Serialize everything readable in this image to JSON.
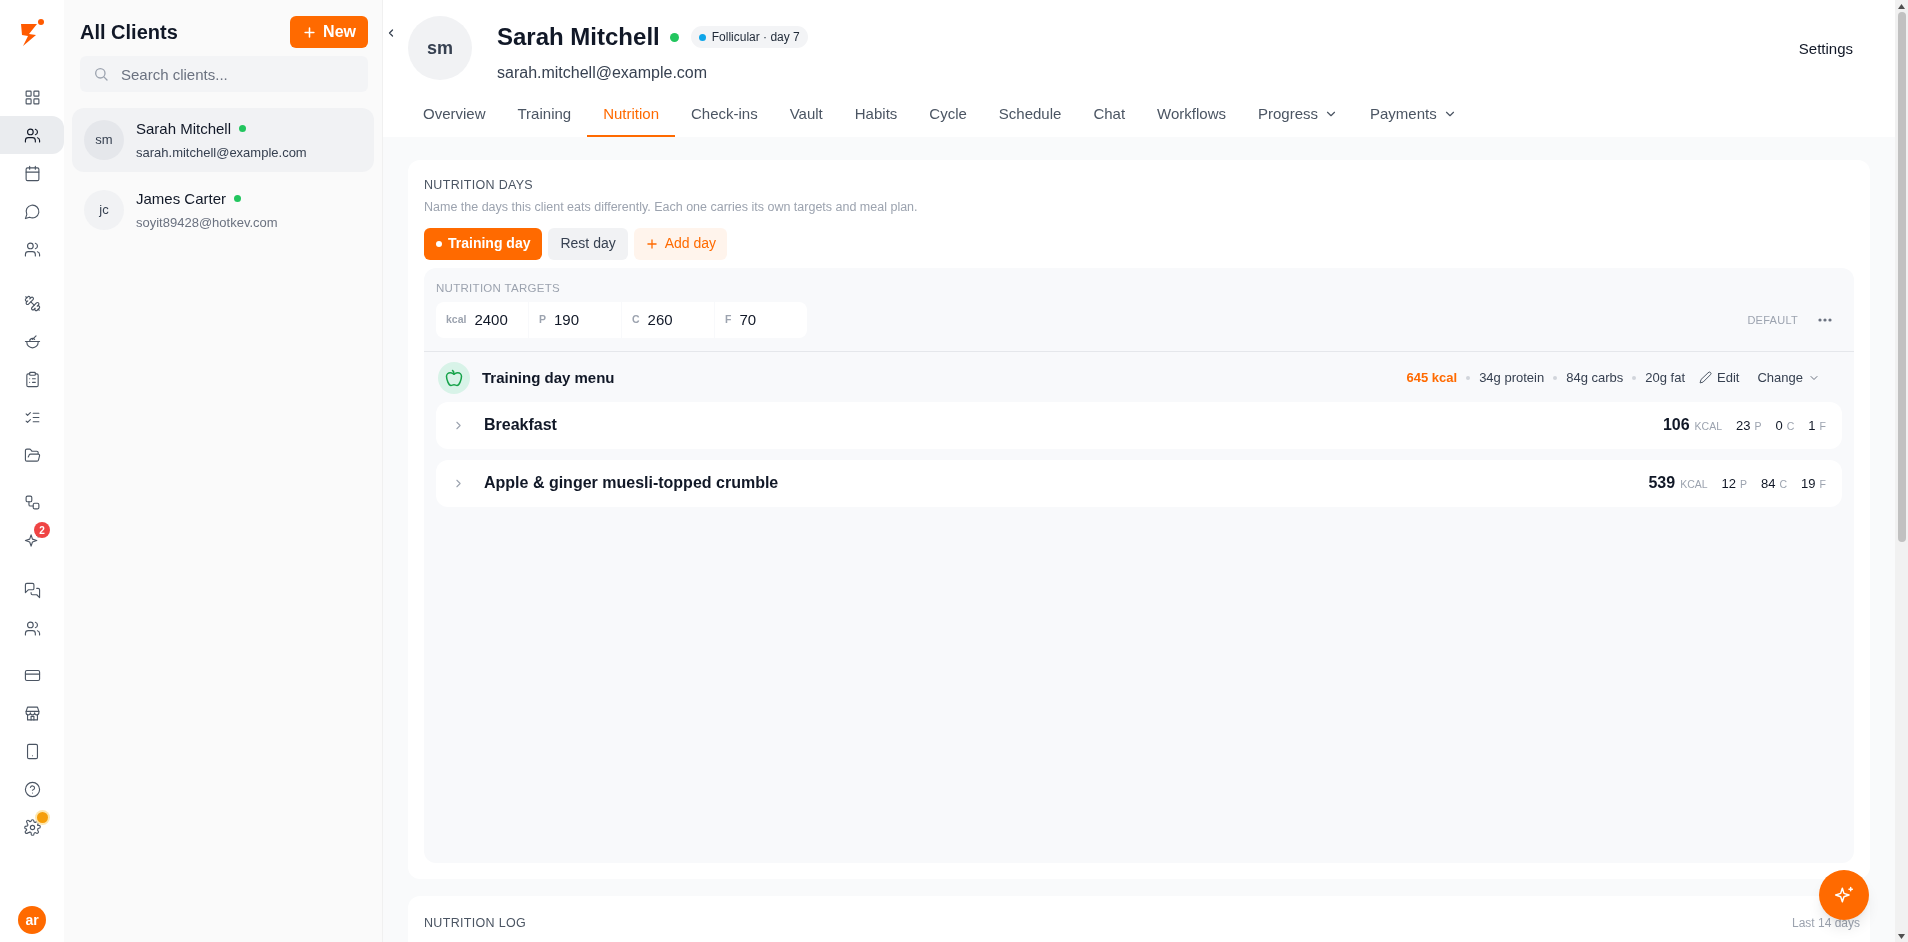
{
  "rail": {
    "items": [
      {
        "selected": false
      },
      {
        "selected": true
      },
      {
        "selected": false
      },
      {
        "selected": false
      },
      {
        "selected": false
      },
      {
        "selected": false
      },
      {
        "selected": false
      },
      {
        "selected": false
      },
      {
        "selected": false
      },
      {
        "selected": false
      },
      {
        "selected": false
      },
      {
        "selected": false,
        "badge": "2"
      },
      {
        "selected": false
      },
      {
        "selected": false
      },
      {
        "selected": false
      },
      {
        "selected": false
      },
      {
        "selected": false
      },
      {
        "selected": false
      },
      {
        "selected": false,
        "alert": true
      }
    ],
    "user_initials": "ar"
  },
  "client_list": {
    "title": "All Clients",
    "new_button": "New",
    "search": {
      "placeholder": "Search clients..."
    },
    "clients": [
      {
        "initials": "sm",
        "name": "Sarah Mitchell",
        "email": "sarah.mitchell@example.com",
        "online": true,
        "selected": true
      },
      {
        "initials": "jc",
        "name": "James Carter",
        "email": "soyit89428@hotkev.com",
        "online": true,
        "selected": false
      }
    ]
  },
  "client_header": {
    "initials": "sm",
    "name": "Sarah Mitchell",
    "online": true,
    "email": "sarah.mitchell@example.com",
    "phase_badge": "Follicular · day 7",
    "settings": "Settings"
  },
  "tabs": [
    {
      "label": "Overview",
      "selected": false,
      "dropdown": false
    },
    {
      "label": "Training",
      "selected": false,
      "dropdown": false
    },
    {
      "label": "Nutrition",
      "selected": true,
      "dropdown": false
    },
    {
      "label": "Check-ins",
      "selected": false,
      "dropdown": false
    },
    {
      "label": "Vault",
      "selected": false,
      "dropdown": false
    },
    {
      "label": "Habits",
      "selected": false,
      "dropdown": false
    },
    {
      "label": "Cycle",
      "selected": false,
      "dropdown": false
    },
    {
      "label": "Schedule",
      "selected": false,
      "dropdown": false
    },
    {
      "label": "Chat",
      "selected": false,
      "dropdown": false
    },
    {
      "label": "Workflows",
      "selected": false,
      "dropdown": false
    },
    {
      "label": "Progress",
      "selected": false,
      "dropdown": true
    },
    {
      "label": "Payments",
      "selected": false,
      "dropdown": true
    }
  ],
  "nutrition_days": {
    "title": "NUTRITION DAYS",
    "description": "Name the days this client eats differently. Each one carries its own targets and meal plan.",
    "days": [
      {
        "label": "Training day",
        "selected": true
      },
      {
        "label": "Rest day",
        "selected": false
      }
    ],
    "add_day": "Add day",
    "targets": {
      "title": "NUTRITION TARGETS",
      "default_label": "DEFAULT",
      "fields": [
        {
          "unit": "kcal",
          "value": "2400"
        },
        {
          "unit": "P",
          "value": "190"
        },
        {
          "unit": "C",
          "value": "260"
        },
        {
          "unit": "F",
          "value": "70"
        }
      ]
    },
    "menu": {
      "title": "Training day menu",
      "kcal": "645 kcal",
      "macros": [
        "34g protein",
        "84g carbs",
        "20g fat"
      ],
      "edit": "Edit",
      "change": "Change",
      "meals": [
        {
          "name": "Breakfast",
          "kcal": "106",
          "kcal_unit": "KCAL",
          "macros": [
            {
              "value": "23",
              "unit": "P"
            },
            {
              "value": "0",
              "unit": "C"
            },
            {
              "value": "1",
              "unit": "F"
            }
          ]
        },
        {
          "name": "Apple & ginger muesli-topped crumble",
          "kcal": "539",
          "kcal_unit": "KCAL",
          "macros": [
            {
              "value": "12",
              "unit": "P"
            },
            {
              "value": "84",
              "unit": "C"
            },
            {
              "value": "19",
              "unit": "F"
            }
          ]
        }
      ]
    }
  },
  "nutrition_log": {
    "title": "NUTRITION LOG",
    "range": "Last 14 days"
  }
}
